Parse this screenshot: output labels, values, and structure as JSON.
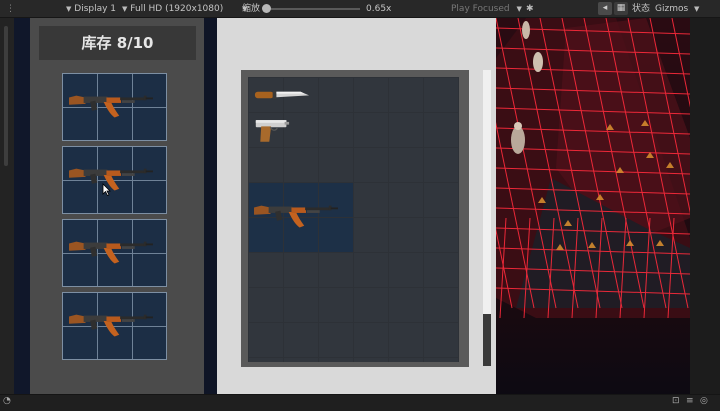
{
  "toolbar": {
    "display": "Display 1",
    "resolution": "Full HD (1920x1080)",
    "scale_label": "缩放",
    "scale_value": "0.65x",
    "play_mode": "Play Focused",
    "stats": "状态",
    "gizmos": "Gizmos"
  },
  "inventory": {
    "title": "库存 8/10",
    "items": [
      {
        "name": "AK-47",
        "icon": "rifle-icon"
      },
      {
        "name": "AK-47",
        "icon": "rifle-icon"
      },
      {
        "name": "AK-47",
        "icon": "rifle-icon"
      },
      {
        "name": "AK-47",
        "icon": "rifle-icon"
      }
    ]
  },
  "storage": {
    "columns": 6,
    "rows": 8,
    "items": [
      {
        "icon": "knife-icon",
        "col": 0,
        "row": 0,
        "w": 2,
        "h": 1
      },
      {
        "icon": "pistol-icon",
        "col": 0,
        "row": 1,
        "w": 2,
        "h": 1
      },
      {
        "icon": "rifle-icon",
        "col": 0,
        "row": 3,
        "w": 3,
        "h": 2
      }
    ]
  },
  "colors": {
    "slot_highlight": "#1d3047",
    "neon_grid": "#ff2b3c",
    "panel_dark": "#383838"
  }
}
